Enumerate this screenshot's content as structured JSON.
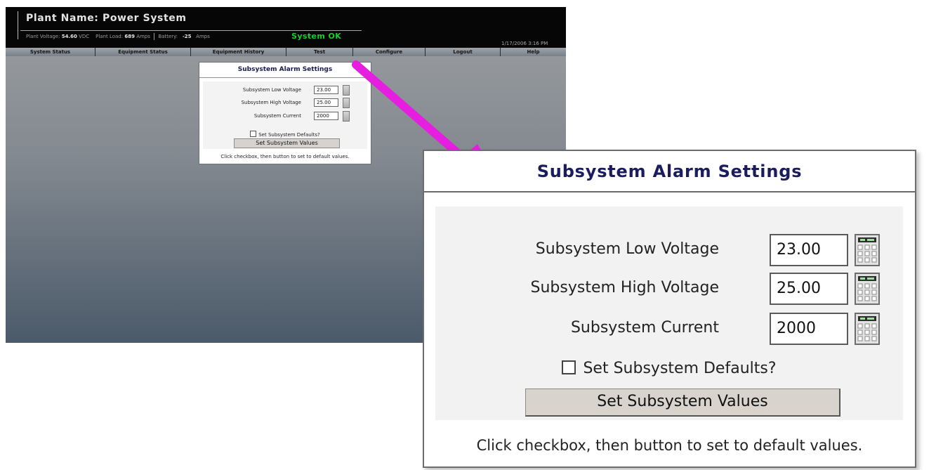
{
  "header": {
    "title": "Plant Name:  Power System",
    "voltage_label": "Plant Voltage:",
    "voltage_value": "54.60",
    "voltage_unit": "VDC",
    "load_label": "Plant Load:",
    "load_value": "689",
    "load_unit": "Amps",
    "battery_label": "Battery:",
    "battery_value": "-25",
    "battery_unit": "Amps",
    "status": "System OK",
    "datetime": "1/17/2006 3:16 PM"
  },
  "nav": [
    "System Status",
    "Equipment Status",
    "Equipment History",
    "Test",
    "Configure",
    "Logout",
    "Help"
  ],
  "dialog": {
    "title": "Subsystem Alarm Settings",
    "rows": [
      {
        "label": "Subsystem Low Voltage",
        "value": "23.00"
      },
      {
        "label": "Subsystem High Voltage",
        "value": "25.00"
      },
      {
        "label": "Subsystem Current",
        "value": "2000"
      }
    ],
    "checkbox_label": "Set Subsystem Defaults?",
    "checkbox_checked": false,
    "button_label": "Set Subsystem Values",
    "hint": "Click checkbox, then button to set to default values."
  },
  "keypad_icon": "calculator-keypad-icon",
  "colors": {
    "status_ok": "#14d12f",
    "arrow": "#e51ee0",
    "dialog_title": "#1a1c5c"
  }
}
